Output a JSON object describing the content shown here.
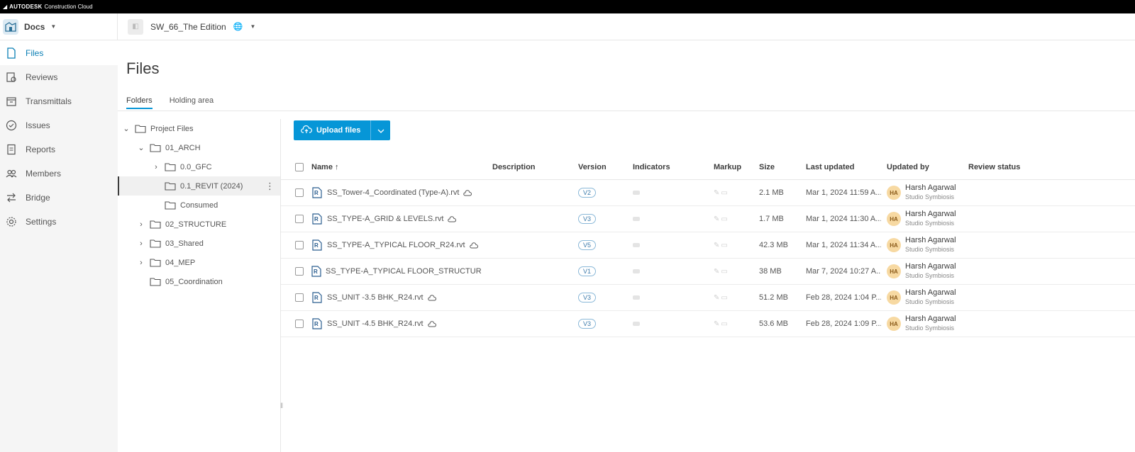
{
  "topbar": {
    "brand": "AUTODESK",
    "product": "Construction Cloud"
  },
  "header": {
    "module": "Docs",
    "project": "SW_66_The Edition"
  },
  "sidebar": {
    "items": [
      {
        "label": "Files",
        "icon": "file-icon",
        "active": true
      },
      {
        "label": "Reviews",
        "icon": "reviews-icon"
      },
      {
        "label": "Transmittals",
        "icon": "transmittals-icon"
      },
      {
        "label": "Issues",
        "icon": "issues-icon"
      },
      {
        "label": "Reports",
        "icon": "reports-icon"
      },
      {
        "label": "Members",
        "icon": "members-icon"
      },
      {
        "label": "Bridge",
        "icon": "bridge-icon"
      },
      {
        "label": "Settings",
        "icon": "settings-icon"
      }
    ]
  },
  "page": {
    "title": "Files"
  },
  "tabs": [
    {
      "label": "Folders",
      "active": true
    },
    {
      "label": "Holding area"
    }
  ],
  "tree": [
    {
      "label": "Project Files",
      "level": 0,
      "expand": "open"
    },
    {
      "label": "01_ARCH",
      "level": 1,
      "expand": "open"
    },
    {
      "label": "0.0_GFC",
      "level": 2,
      "expand": "closed"
    },
    {
      "label": "0.1_REVIT (2024)",
      "level": 2,
      "expand": "none",
      "selected": true
    },
    {
      "label": "Consumed",
      "level": 2,
      "expand": "none"
    },
    {
      "label": "02_STRUCTURE",
      "level": 1,
      "expand": "closed"
    },
    {
      "label": "03_Shared",
      "level": 1,
      "expand": "closed"
    },
    {
      "label": "04_MEP",
      "level": 1,
      "expand": "closed"
    },
    {
      "label": "05_Coordination",
      "level": 1,
      "expand": "none"
    }
  ],
  "toolbar": {
    "upload_label": "Upload files"
  },
  "table": {
    "columns": {
      "name": "Name",
      "description": "Description",
      "version": "Version",
      "indicators": "Indicators",
      "markup": "Markup",
      "size": "Size",
      "updated": "Last updated",
      "updated_by": "Updated by",
      "review": "Review status"
    },
    "rows": [
      {
        "name": "SS_Tower-4_Coordinated (Type-A).rvt",
        "version": "V2",
        "size": "2.1 MB",
        "updated": "Mar 1, 2024 11:59 A...",
        "avatar": "HA",
        "user": "Harsh Agarwal",
        "org": "Studio Symbiosis"
      },
      {
        "name": "SS_TYPE-A_GRID & LEVELS.rvt",
        "version": "V3",
        "size": "1.7 MB",
        "updated": "Mar 1, 2024 11:30 A...",
        "avatar": "HA",
        "user": "Harsh Agarwal",
        "org": "Studio Symbiosis"
      },
      {
        "name": "SS_TYPE-A_TYPICAL FLOOR_R24.rvt",
        "version": "V5",
        "size": "42.3 MB",
        "updated": "Mar 1, 2024 11:34 A...",
        "avatar": "HA",
        "user": "Harsh Agarwal",
        "org": "Studio Symbiosis"
      },
      {
        "name": "SS_TYPE-A_TYPICAL FLOOR_STRUCTURE...",
        "version": "V1",
        "size": "38 MB",
        "updated": "Mar 7, 2024 10:27 A...",
        "avatar": "HA",
        "user": "Harsh Agarwal",
        "org": "Studio Symbiosis"
      },
      {
        "name": "SS_UNIT -3.5 BHK_R24.rvt",
        "version": "V3",
        "size": "51.2 MB",
        "updated": "Feb 28, 2024 1:04 P...",
        "avatar": "HA",
        "user": "Harsh Agarwal",
        "org": "Studio Symbiosis"
      },
      {
        "name": "SS_UNIT -4.5 BHK_R24.rvt",
        "version": "V3",
        "size": "53.6 MB",
        "updated": "Feb 28, 2024 1:09 P...",
        "avatar": "HA",
        "user": "Harsh Agarwal",
        "org": "Studio Symbiosis"
      }
    ]
  },
  "colors": {
    "accent": "#0696d7",
    "sidebar_bg": "#f5f5f5",
    "active_text": "#0b7fb5"
  }
}
